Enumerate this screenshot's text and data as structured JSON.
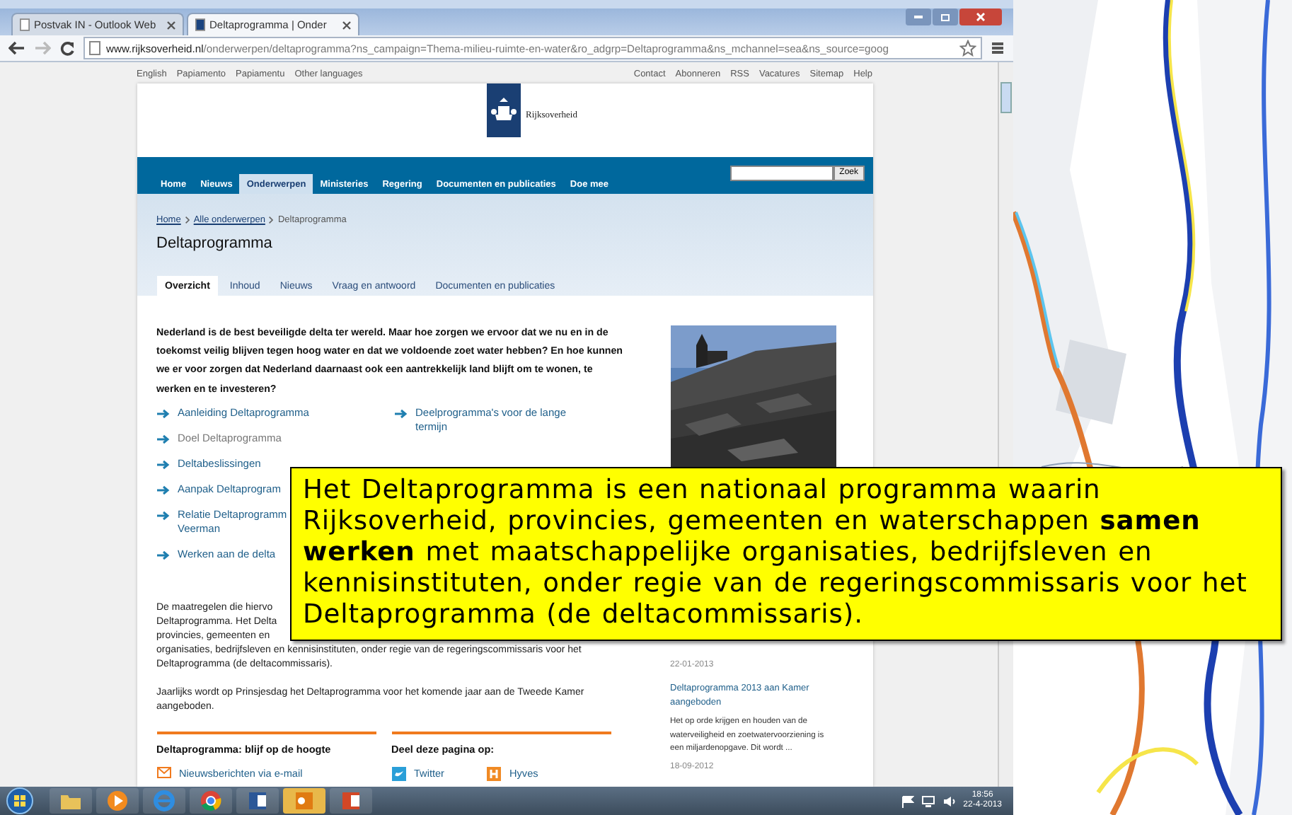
{
  "browser": {
    "tabs": [
      {
        "label": "Postvak IN - Outlook Web",
        "selected": false
      },
      {
        "label": "Deltaprogramma | Onder",
        "selected": true
      }
    ],
    "url_host": "www.rijksoverheid.nl",
    "url_path": "/onderwerpen/deltaprogramma?ns_campaign=Thema-milieu-ruimte-en-water&ro_adgrp=Deltaprogramma&ns_mchannel=sea&ns_source=goog"
  },
  "site": {
    "languages": [
      "English",
      "Papiamento",
      "Papiamentu",
      "Other languages"
    ],
    "utility_links": [
      "Contact",
      "Abonneren",
      "RSS",
      "Vacatures",
      "Sitemap",
      "Help"
    ],
    "logo_text": "Rijksoverheid",
    "nav": [
      {
        "label": "Home",
        "selected": false
      },
      {
        "label": "Nieuws",
        "selected": false
      },
      {
        "label": "Onderwerpen",
        "selected": true
      },
      {
        "label": "Ministeries",
        "selected": false
      },
      {
        "label": "Regering",
        "selected": false
      },
      {
        "label": "Documenten en publicaties",
        "selected": false
      },
      {
        "label": "Doe mee",
        "selected": false
      }
    ],
    "search_button": "Zoek",
    "breadcrumb": [
      "Home",
      "Alle onderwerpen",
      "Deltaprogramma"
    ],
    "title": "Deltaprogramma",
    "tabs": [
      {
        "label": "Overzicht",
        "selected": true
      },
      {
        "label": "Inhoud",
        "selected": false
      },
      {
        "label": "Nieuws",
        "selected": false
      },
      {
        "label": "Vraag en antwoord",
        "selected": false
      },
      {
        "label": "Documenten en publicaties",
        "selected": false
      }
    ],
    "intro": "Nederland is de best beveiligde delta ter wereld. Maar hoe zorgen we ervoor dat we nu en in de toekomst veilig blijven tegen hoog water en dat we voldoende zoet water hebben? En hoe kunnen we er voor zorgen dat Nederland daarnaast ook een aantrekkelijk land blijft om te wonen, te werken en te investeren?",
    "links_left": [
      {
        "label": "Aanleiding Deltaprogramma",
        "visited": false
      },
      {
        "label": "Doel Deltaprogramma",
        "visited": true
      },
      {
        "label": "Deltabeslissingen",
        "visited": false
      },
      {
        "label": "Aanpak Deltaprogram",
        "visited": false
      },
      {
        "label": "Relatie Deltaprogramm\nVeerman",
        "visited": false
      },
      {
        "label": "Werken aan de delta",
        "visited": false
      }
    ],
    "links_right": [
      {
        "label": "Deelprogramma's voor de lange\ntermijn",
        "visited": false
      }
    ],
    "paragraph_lines": [
      "De maatregelen die hiervo",
      "Deltaprogramma. Het Delta",
      "provincies, gemeenten en"
    ],
    "paragraph_tail": "organisaties, bedrijfsleven en kennisinstituten, onder regie van de regeringscommissaris voor het Deltaprogramma (de deltacommissaris).",
    "annual_text": "Jaarlijks wordt op Prinsjesdag het Deltaprogramma voor het komende jaar aan de Tweede Kamer aangeboden.",
    "stay_updated": {
      "heading": "Deltaprogramma: blijf op de hoogte",
      "items": [
        {
          "label": "Nieuwsberichten via e-mail",
          "kind": "email"
        }
      ]
    },
    "share": {
      "heading": "Deel deze pagina op:",
      "items": [
        {
          "label": "Twitter",
          "kind": "twitter"
        },
        {
          "label": "Hyves",
          "kind": "hyves"
        }
      ]
    },
    "sidebar": {
      "date": "22-01-2013",
      "news": [
        {
          "title": "Deltaprogramma 2013 aan Kamer aangeboden",
          "summary": "Het op orde krijgen en houden van de waterveiligheid en zoetwatervoorziening is een miljardenopgave. Dit wordt ...",
          "date": "18-09-2012"
        }
      ]
    }
  },
  "callout": "Het Deltaprogramma is een nationaal programma waarin Rijksoverheid, provincies, gemeenten en waterschappen **samen werken** met maatschappelijke organisaties, bedrijfsleven en kennisinstituten, onder regie van de regeringscommissaris voor het Deltaprogramma (de deltacommissaris).",
  "taskbar": {
    "time": "18:56",
    "date": "22-4-2013"
  }
}
